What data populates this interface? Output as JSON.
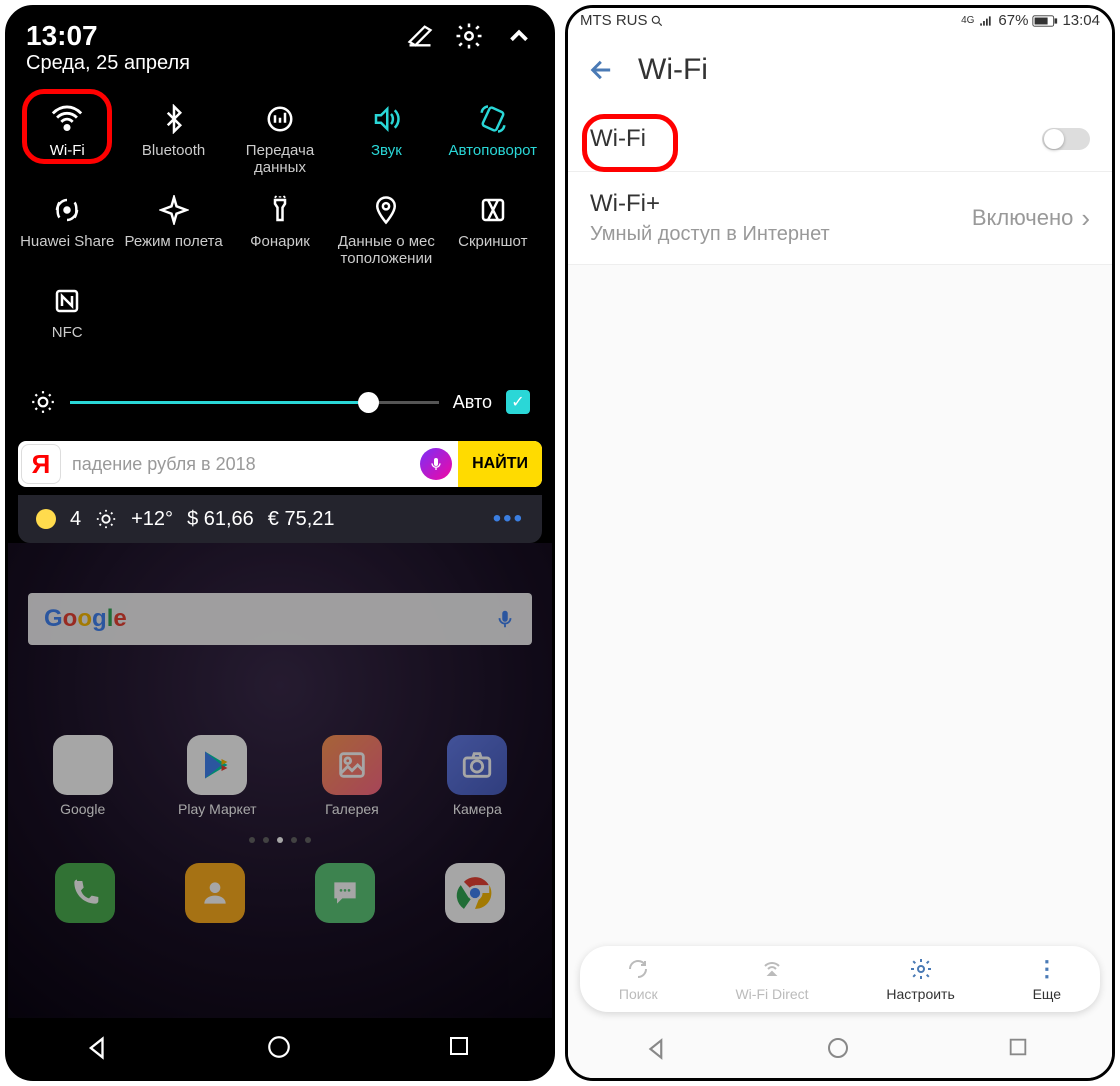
{
  "left": {
    "time": "13:07",
    "date": "Среда, 25 апреля",
    "qs": [
      {
        "label": "Wi-Fi"
      },
      {
        "label": "Bluetooth"
      },
      {
        "label": "Передача данных"
      },
      {
        "label": "Звук"
      },
      {
        "label": "Автоповорот"
      },
      {
        "label": "Huawei Share"
      },
      {
        "label": "Режим полета"
      },
      {
        "label": "Фонарик"
      },
      {
        "label": "Данные о мес тоположении"
      },
      {
        "label": "Скриншот"
      },
      {
        "label": "NFC"
      }
    ],
    "brightness_auto": "Авто",
    "yandex": {
      "logo": "Я",
      "placeholder": "падение рубля в 2018",
      "find": "НАЙТИ"
    },
    "weather": {
      "temp1": "4",
      "temp2": "+12°",
      "usd": "$ 61,66",
      "eur": "€ 75,21"
    },
    "google": {
      "g": "G",
      "o1": "o",
      "o2": "o",
      "g2": "g",
      "l": "l",
      "e": "e"
    },
    "apps": [
      {
        "label": "Google"
      },
      {
        "label": "Play Маркет"
      },
      {
        "label": "Галерея"
      },
      {
        "label": "Камера"
      }
    ]
  },
  "right": {
    "carrier": "MTS RUS",
    "battery": "67%",
    "time": "13:04",
    "signal": "4G",
    "header": "Wi-Fi",
    "wifi_row": "Wi-Fi",
    "wifiplus_title": "Wi-Fi+",
    "wifiplus_sub": "Умный доступ в Интернет",
    "wifiplus_value": "Включено",
    "bottom": [
      {
        "label": "Поиск"
      },
      {
        "label": "Wi-Fi Direct"
      },
      {
        "label": "Настроить"
      },
      {
        "label": "Еще"
      }
    ]
  }
}
